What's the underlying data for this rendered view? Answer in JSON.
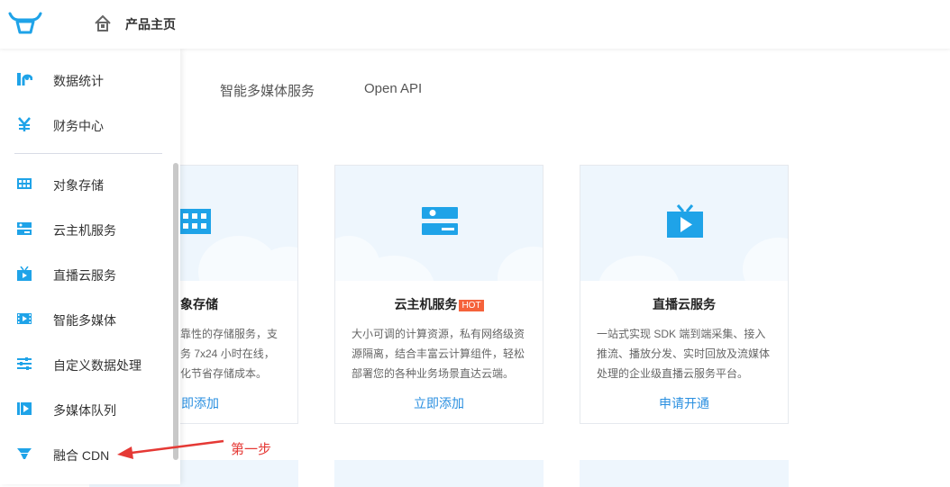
{
  "header": {
    "title": "产品主页"
  },
  "sidebar": {
    "items": [
      {
        "label": "数据统计",
        "icon": "chart-icon"
      },
      {
        "label": "财务中心",
        "icon": "yen-icon"
      },
      {
        "label": "对象存储",
        "icon": "storage-icon"
      },
      {
        "label": "云主机服务",
        "icon": "server-icon"
      },
      {
        "label": "直播云服务",
        "icon": "tv-icon"
      },
      {
        "label": "智能多媒体",
        "icon": "film-icon"
      },
      {
        "label": "自定义数据处理",
        "icon": "sliders-icon"
      },
      {
        "label": "多媒体队列",
        "icon": "queue-icon"
      },
      {
        "label": "融合 CDN",
        "icon": "cdn-icon"
      }
    ]
  },
  "tabs": [
    {
      "label": "智能多媒体服务"
    },
    {
      "label": "Open API"
    }
  ],
  "cards": [
    {
      "title": "象存储",
      "desc": [
        "靠性的存储服务，支",
        "务 7x24 小时在线，",
        "化节省存储成本。"
      ],
      "link": "即添加"
    },
    {
      "title": "云主机服务",
      "badge": "HOT",
      "desc": [
        "大小可调的计算资源，私有网络级资",
        "源隔离，结合丰富云计算组件，轻松",
        "部署您的各种业务场景直达云端。"
      ],
      "link": "立即添加"
    },
    {
      "title": "直播云服务",
      "desc": [
        "一站式实现 SDK 端到端采集、接入",
        "推流、播放分发、实时回放及流媒体",
        "处理的企业级直播云服务平台。"
      ],
      "link": "申请开通"
    }
  ],
  "annotation": {
    "text": "第一步"
  },
  "colors": {
    "accent": "#2a8fe0",
    "icon_blue": "#1fa3e8",
    "hot": "#f5623b",
    "annotation": "#e53935"
  }
}
